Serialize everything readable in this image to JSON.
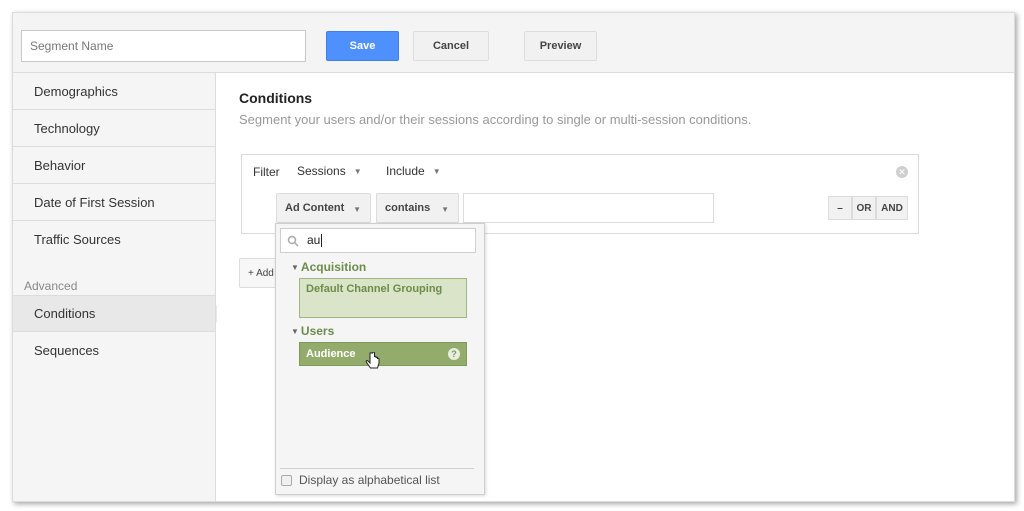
{
  "topbar": {
    "segment_name_placeholder": "Segment Name",
    "segment_name_value": "",
    "save_label": "Save",
    "cancel_label": "Cancel",
    "preview_label": "Preview",
    "save_color": "#4d90fe"
  },
  "sidebar": {
    "items": [
      {
        "label": "Demographics"
      },
      {
        "label": "Technology"
      },
      {
        "label": "Behavior"
      },
      {
        "label": "Date of First Session"
      },
      {
        "label": "Traffic Sources"
      }
    ],
    "advanced_heading": "Advanced",
    "advanced_items": [
      {
        "label": "Conditions",
        "active": true
      },
      {
        "label": "Sequences",
        "active": false
      }
    ]
  },
  "main": {
    "title": "Conditions",
    "subtitle": "Segment your users and/or their sessions according to single or multi-session conditions.",
    "filter": {
      "label": "Filter",
      "scope": "Sessions",
      "mode": "Include",
      "dimension": "Ad Content",
      "operator": "contains",
      "value": "",
      "minus_label": "–",
      "or_label": "OR",
      "and_label": "AND"
    },
    "add_filter_label": "+ Add"
  },
  "dropdown": {
    "search_value": "au",
    "groups": [
      {
        "label": "Acquisition",
        "options": [
          {
            "label": "Default Channel Grouping"
          }
        ]
      },
      {
        "label": "Users",
        "options": [
          {
            "label": "Audience",
            "hovered": true
          }
        ]
      }
    ],
    "checkbox_label": "Display as alphabetical list",
    "checkbox_checked": false,
    "group_color": "#6c8c4a",
    "hover_color": "#93ac6c"
  }
}
